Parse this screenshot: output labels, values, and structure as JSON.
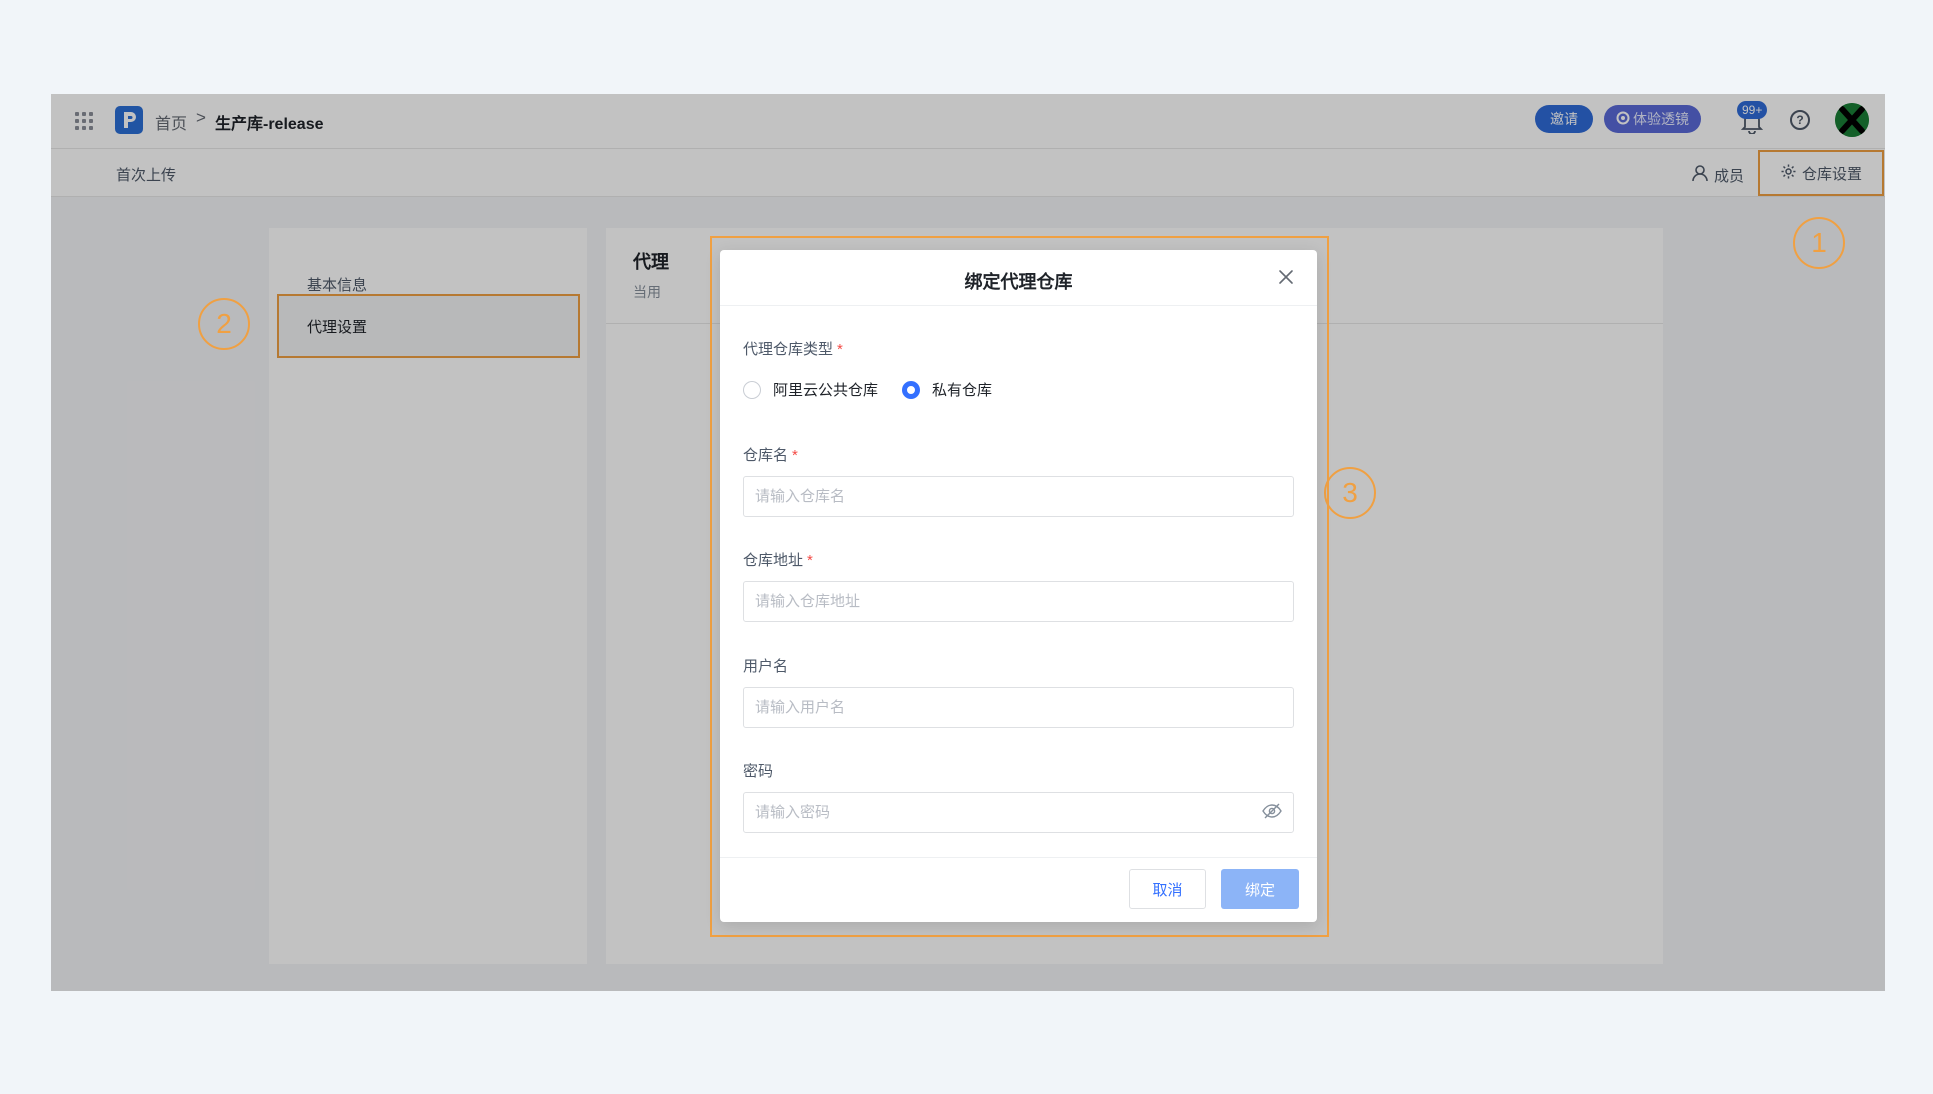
{
  "header": {
    "breadcrumb_home": "首页",
    "breadcrumb_separator": ">",
    "breadcrumb_current": "生产库-release",
    "invite_label": "邀请",
    "trial_label": "体验透镜",
    "notification_count": "99+",
    "help_glyph": "?"
  },
  "subheader": {
    "first_upload": "首次上传",
    "members": "成员",
    "repo_settings": "仓库设置"
  },
  "sidebar": {
    "items": [
      {
        "label": "基本信息"
      },
      {
        "label": "代理设置"
      }
    ]
  },
  "main": {
    "title": "代理",
    "description": "当用"
  },
  "markers": [
    "1",
    "2",
    "3"
  ],
  "modal": {
    "title": "绑定代理仓库",
    "type_label": "代理仓库类型",
    "required_mark": "*",
    "type_options": [
      {
        "label": "阿里云公共仓库",
        "selected": false
      },
      {
        "label": "私有仓库",
        "selected": true
      }
    ],
    "repo_name_label": "仓库名",
    "repo_name_placeholder": "请输入仓库名",
    "repo_url_label": "仓库地址",
    "repo_url_placeholder": "请输入仓库地址",
    "username_label": "用户名",
    "username_placeholder": "请输入用户名",
    "password_label": "密码",
    "password_placeholder": "请输入密码",
    "cancel_label": "取消",
    "bind_label": "绑定"
  },
  "colors": {
    "accent": "#3370ff",
    "highlight": "#f0a042",
    "invite": "#2e6bd8",
    "trial": "#5a6ad8"
  }
}
